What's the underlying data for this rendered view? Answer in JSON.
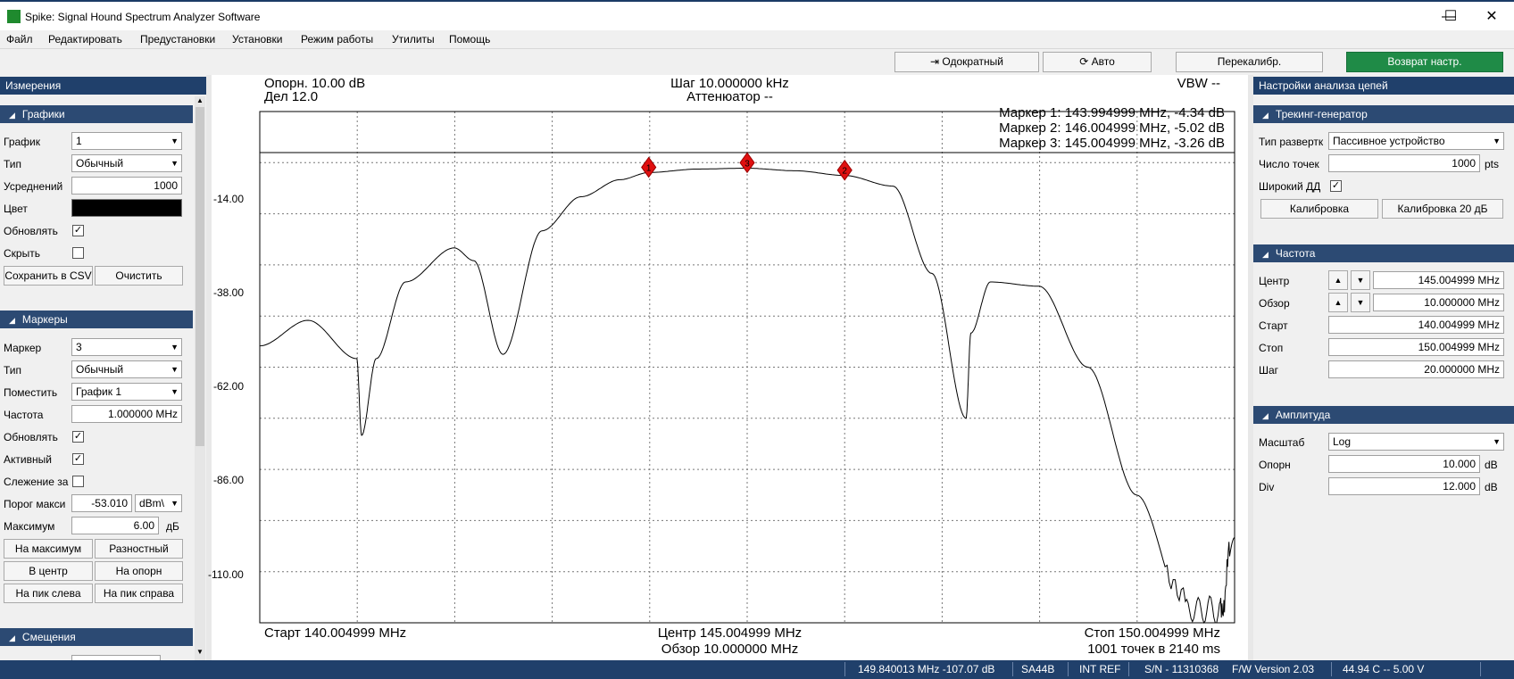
{
  "window": {
    "title": "Spike: Signal Hound Spectrum Analyzer Software",
    "minimize": "—",
    "maximize": "☐",
    "close": "✕"
  },
  "menu": [
    "Файл",
    "Редактировать",
    "Предустановки",
    "Установки",
    "Режим работы",
    "Утилиты",
    "Помощь"
  ],
  "toolbar": {
    "single": "Одократный",
    "auto": "Авто",
    "recal": "Перекалибр.",
    "preset": "Возврат настр."
  },
  "left": {
    "panel_title": "Измерения",
    "traces": {
      "header": "Графики",
      "graph_label": "График",
      "graph_value": "1",
      "type_label": "Тип",
      "type_value": "Обычный",
      "avg_label": "Усреднений",
      "avg_value": "1000",
      "color_label": "Цвет",
      "update_label": "Обновлять",
      "update_checked": "✓",
      "hide_label": "Скрыть",
      "hide_checked": "",
      "save_csv": "Сохранить в CSV",
      "clear": "Очистить"
    },
    "markers": {
      "header": "Маркеры",
      "marker_label": "Маркер",
      "marker_value": "3",
      "type_label": "Тип",
      "type_value": "Обычный",
      "place_label": "Поместить",
      "place_value": "График 1",
      "freq_label": "Частота",
      "freq_value": "1.000000 MHz",
      "update_label": "Обновлять",
      "update_checked": "✓",
      "active_label": "Активный",
      "active_checked": "✓",
      "track_label": "Слежение за",
      "track_checked": "",
      "peak_thr_label": "Порог макси",
      "peak_thr_value": "-53.010",
      "peak_thr_unit": "dBm\\",
      "max_label": "Максимум",
      "max_value": "6.00",
      "max_unit": "дБ",
      "to_peak": "На максимум",
      "delta": "Разностный",
      "to_center": "В центр",
      "to_ref": "На опорн",
      "peak_left": "На пик слева",
      "peak_right": "На пик справа"
    },
    "offsets": {
      "header": "Смещения"
    }
  },
  "plot": {
    "ref": "Опорн. 10.00 dB",
    "div": "Дел 12.0",
    "step": "Шаг 10.000000 kHz",
    "atten": "Аттенюатор --",
    "vbw": "VBW --",
    "marker_lines": [
      "Маркер 1: 143.994999 MHz, -4.34 dB",
      "Маркер 2: 146.004999 MHz, -5.02 dB",
      "Маркер 3: 145.004999 MHz, -3.26 dB"
    ],
    "y_labels": [
      "-14.00",
      "-38.00",
      "-62.00",
      "-86.00",
      "-110.00"
    ],
    "start": "Старт 140.004999 MHz",
    "center": "Центр 145.004999 MHz",
    "span": "Обзор 10.000000 MHz",
    "stop": "Стоп 150.004999 MHz",
    "points": "1001 точек в 2140 ms",
    "marker_labels": [
      "1",
      "3",
      "2"
    ]
  },
  "right": {
    "panel_title": "Настройки анализа цепей",
    "tg": {
      "header": "Трекинг-генератор",
      "sweep_label": "Тип развертк",
      "sweep_value": "Пассивное устройство",
      "points_label": "Число точек",
      "points_value": "1000",
      "points_unit": "pts",
      "wide_label": "Широкий ДД",
      "wide_checked": "✓",
      "cal": "Калибровка",
      "cal20": "Калибровка 20 дБ"
    },
    "freq": {
      "header": "Частота",
      "center_label": "Центр",
      "center_value": "145.004999 MHz",
      "span_label": "Обзор",
      "span_value": "10.000000 MHz",
      "start_label": "Старт",
      "start_value": "140.004999 MHz",
      "stop_label": "Стоп",
      "stop_value": "150.004999 MHz",
      "step_label": "Шаг",
      "step_value": "20.000000 MHz"
    },
    "amp": {
      "header": "Амплитуда",
      "scale_label": "Масштаб",
      "scale_value": "Log",
      "ref_label": "Опорн",
      "ref_value": "10.000",
      "ref_unit": "dB",
      "div_label": "Div",
      "div_value": "12.000",
      "div_unit": "dB"
    }
  },
  "status": {
    "readout": "149.840013 MHz  -107.07 dB",
    "device": "SA44B",
    "ref": "INT REF",
    "serial": "S/N - 11310368",
    "fw": "F/W Version 2.03",
    "temp": "44.94 C  --  5.00 V"
  },
  "chart_data": {
    "type": "line",
    "x_unit": "MHz",
    "x_range": [
      140.004999,
      150.004999
    ],
    "ylim": [
      -110,
      10
    ],
    "grid": true,
    "x": [
      140.005,
      140.5,
      141.0,
      141.05,
      141.2,
      141.5,
      142.0,
      142.2,
      142.5,
      142.9,
      143.3,
      143.7,
      144.0,
      144.5,
      145.0,
      145.5,
      146.0,
      146.5,
      146.9,
      147.25,
      147.3,
      147.5,
      148.0,
      148.5,
      149.0,
      149.5,
      149.85,
      150.005
    ],
    "y": [
      -45,
      -39,
      -48,
      -66,
      -48,
      -30,
      -22,
      -25,
      -47,
      -18,
      -10,
      -6,
      -4.3,
      -3.5,
      -3.3,
      -3.9,
      -5.0,
      -7.5,
      -28,
      -62,
      -42,
      -30,
      -31,
      -50,
      -80,
      -107,
      -107,
      -90
    ]
  }
}
